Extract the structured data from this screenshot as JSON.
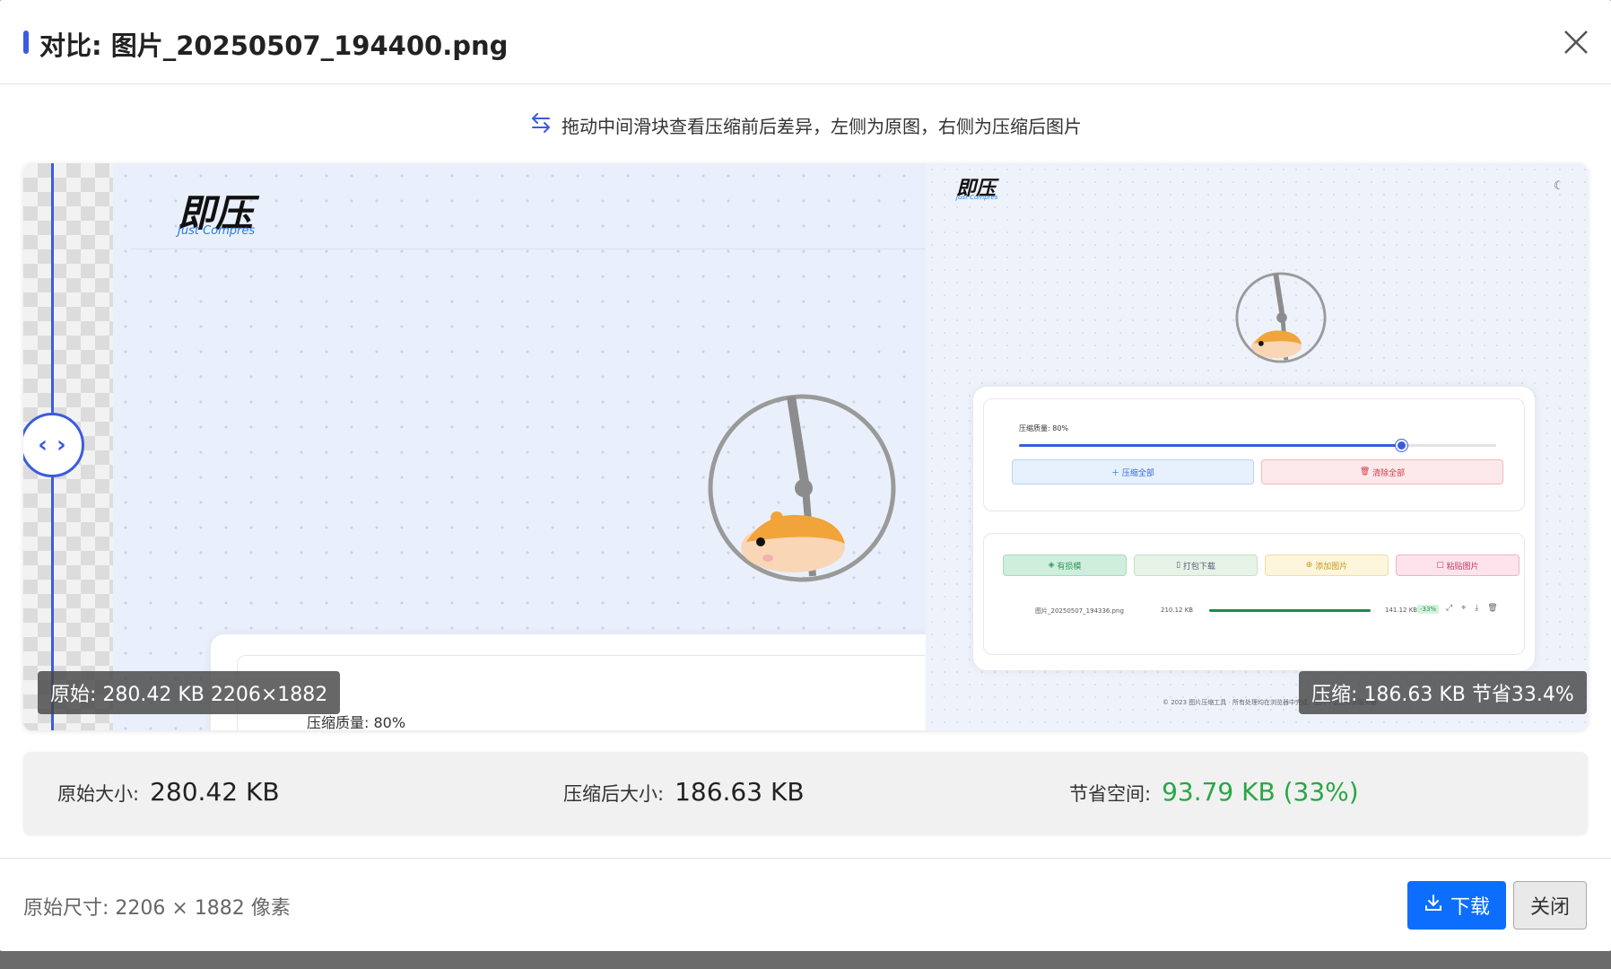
{
  "dialog": {
    "title": "对比: 图片_20250507_194400.png",
    "hint": "拖动中间滑块查看压缩前后差异，左侧为原图，右侧为压缩后图片"
  },
  "compare": {
    "badge_original": "原始: 280.42 KB 2206×1882",
    "badge_compressed": "压缩: 186.63 KB 节省33.4%",
    "original_preview": {
      "logo": "即压",
      "logo_sub": "Just Compres",
      "quality_label": "压缩质量: 80%"
    },
    "compressed_preview": {
      "logo": "即压",
      "logo_sub": "Just Compres",
      "quality_label": "压缩质量: 80%",
      "quality_percent": 80,
      "compress_all": "压缩全部",
      "clear_all": "清除全部",
      "btn_green": "有损模",
      "btn_pack": "打包下载",
      "btn_add": "添加图片",
      "btn_paste": "粘贴图片",
      "file_name": "图片_20250507_194336.png",
      "file_size_before": "210.12 KB",
      "file_size_after": "141.12 KB",
      "file_saving": "-33%",
      "file_progress": 100,
      "footer": "© 2023 图片压缩工具 · 所有处理均在浏览器中完成，图片不会上传到服务器"
    }
  },
  "stats": {
    "original_label": "原始大小:",
    "original_value": "280.42 KB",
    "compressed_label": "压缩后大小:",
    "compressed_value": "186.63 KB",
    "saved_label": "节省空间:",
    "saved_value": "93.79 KB (33%)"
  },
  "footer": {
    "dimensions": "原始尺寸: 2206 × 1882 像素",
    "download_label": "下载",
    "close_label": "关闭"
  },
  "colors": {
    "accent": "#3b5be0",
    "primary_button": "#0d6efd",
    "saved_green": "#28a745"
  }
}
